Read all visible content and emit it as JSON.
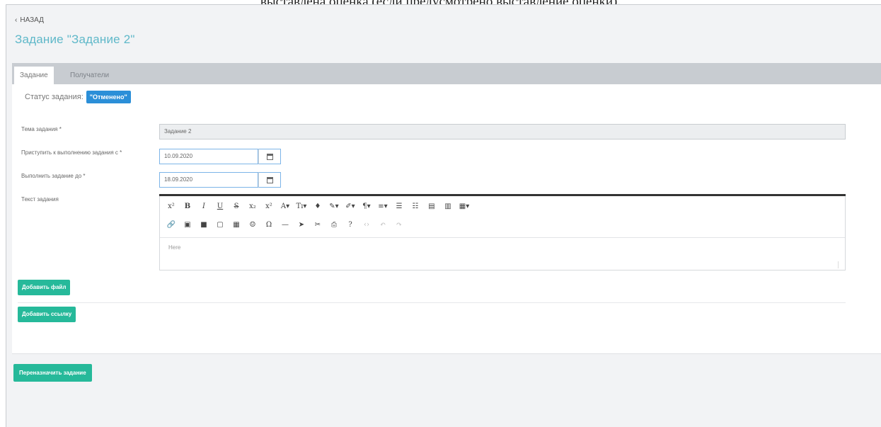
{
  "doc_fragment": "выставлена оценка (если предусмотрено выставление оценки).",
  "header": {
    "back_label": "НАЗАД",
    "page_title": "Задание \"Задание 2\""
  },
  "tabs": [
    {
      "label": "Задание",
      "active": true
    },
    {
      "label": "Получатели",
      "active": false
    }
  ],
  "status": {
    "label": "Статус задания:",
    "badge": "\"Отменено\""
  },
  "form": {
    "topic_label": "Тема задания *",
    "topic_value": "Задание 2",
    "start_label": "Приступить к выполнению задания с *",
    "start_value": "10.09.2020",
    "due_label": "Выполнить задание до *",
    "due_value": "18.09.2020",
    "text_label": "Текст задания"
  },
  "editor": {
    "toolbar_row1": [
      "x²",
      "B",
      "I",
      "U",
      "S",
      "x₂",
      "x²",
      "A▾",
      "Tı▾",
      "♦",
      "✎▾",
      "✐▾",
      "¶▾",
      "≡▾",
      "☰",
      "☷",
      "▤",
      "▥",
      "▦▾"
    ],
    "toolbar_row2": [
      "🔗",
      "▣",
      "■",
      "▢",
      "▦",
      "☺",
      "Ω",
      "—",
      "➤",
      "✂",
      "⎙",
      "?",
      "‹›",
      "↶",
      "↷"
    ],
    "placeholder": "Here"
  },
  "buttons": {
    "add_file": "Добавить файл",
    "add_link": "Добавить ссылку",
    "reassign": "Переназначить задание"
  },
  "colors": {
    "title": "#5fb8c9",
    "badge": "#2b8fd8",
    "green_button": "#26b99a"
  }
}
